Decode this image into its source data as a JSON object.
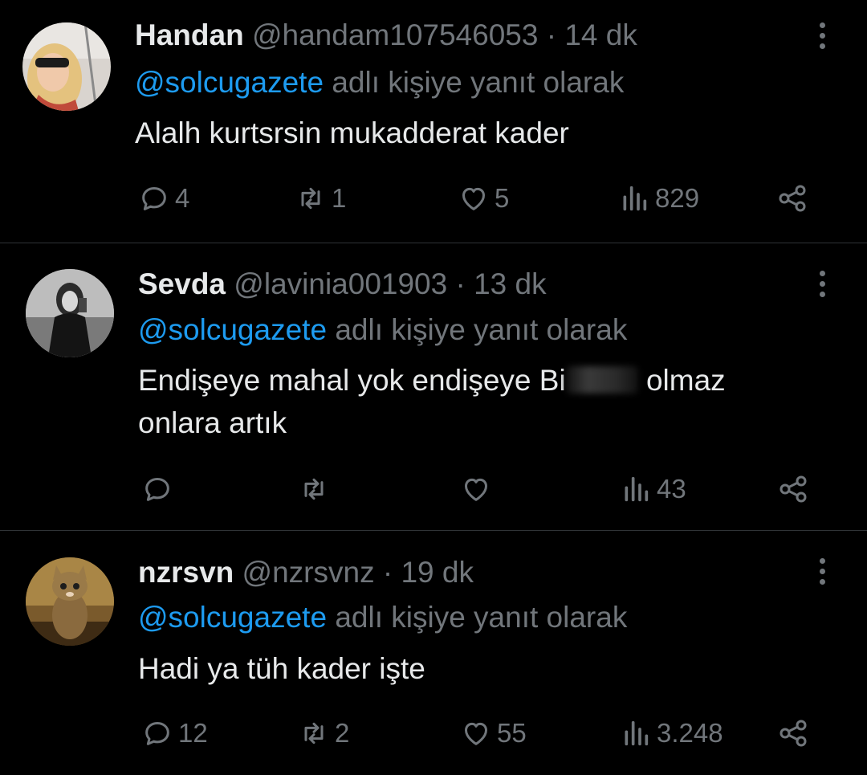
{
  "tweets": [
    {
      "name": "Handan",
      "handle": "@handam107546053",
      "sep": "·",
      "time": "14 dk",
      "reply_mention": "@solcugazete",
      "reply_suffix": "adlı kişiye yanıt olarak",
      "text_before": "Alalh kurtsrsin mukadderat kader",
      "text_after": "",
      "replies": "4",
      "retweets": "1",
      "likes": "5",
      "views": "829"
    },
    {
      "name": "Sevda",
      "handle": "@lavinia001903",
      "sep": "·",
      "time": "13 dk",
      "reply_mention": "@solcugazete",
      "reply_suffix": "adlı kişiye yanıt olarak",
      "text_before": "Endişeye mahal yok endişeye Bi",
      "text_after": "olmaz onlara artık",
      "replies": "",
      "retweets": "",
      "likes": "",
      "views": "43"
    },
    {
      "name": "nzrsvn",
      "handle": "@nzrsvnz",
      "sep": "·",
      "time": "19 dk",
      "reply_mention": "@solcugazete",
      "reply_suffix": "adlı kişiye yanıt olarak",
      "text_before": "Hadi ya tüh kader işte",
      "text_after": "",
      "replies": "12",
      "retweets": "2",
      "likes": "55",
      "views": "3.248"
    }
  ],
  "icons": {
    "reply": "reply-icon",
    "retweet": "retweet-icon",
    "like": "heart-icon",
    "views": "views-icon",
    "share": "share-icon",
    "more": "more-vertical-icon"
  },
  "colors": {
    "background": "#000000",
    "text": "#e7e9ea",
    "muted": "#71767b",
    "link": "#1d9bf0",
    "divider": "#2f3336"
  }
}
